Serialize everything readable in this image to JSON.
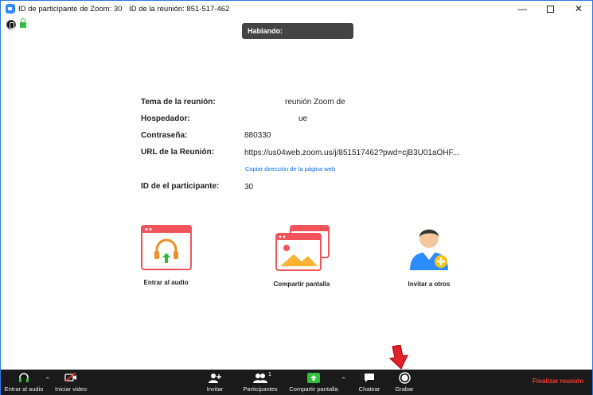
{
  "window": {
    "participant_id_title": "ID de participante de Zoom: 30",
    "meeting_id_title": "ID de la reunión: 851-517-462"
  },
  "speaking": {
    "label": "Hablando:"
  },
  "meeting_info": {
    "topic_label": "Tema de la reunión:",
    "topic_value": "reunión Zoom de",
    "host_label": "Hospedador:",
    "host_value": "ue",
    "password_label": "Contraseña:",
    "password_value": "880330",
    "url_label": "URL de la Reunión:",
    "url_value": "https://us04web.zoom.us/j/851517462?pwd=cjB3U01aOHF...",
    "copy_link": "Copiar dirección de la página web",
    "participant_id_label": "ID de el participante:",
    "participant_id_value": "30"
  },
  "actions": {
    "join_audio": "Entrar al audio",
    "share_screen": "Compartir pantalla",
    "invite_others": "Invitar a otros"
  },
  "toolbar": {
    "join_audio": "Entrar al audio",
    "start_video": "Iniciar video",
    "invite": "Invitar",
    "participants": "Participantes",
    "participants_count": "1",
    "share_screen": "Compartir pantalla",
    "chat": "Chatear",
    "record": "Grabar",
    "end_meeting": "Finalizar reunión"
  },
  "colors": {
    "accent_blue": "#0e71eb",
    "card_red": "#f2545b",
    "end_red": "#ff3b30",
    "share_green": "#2fbf3a"
  }
}
